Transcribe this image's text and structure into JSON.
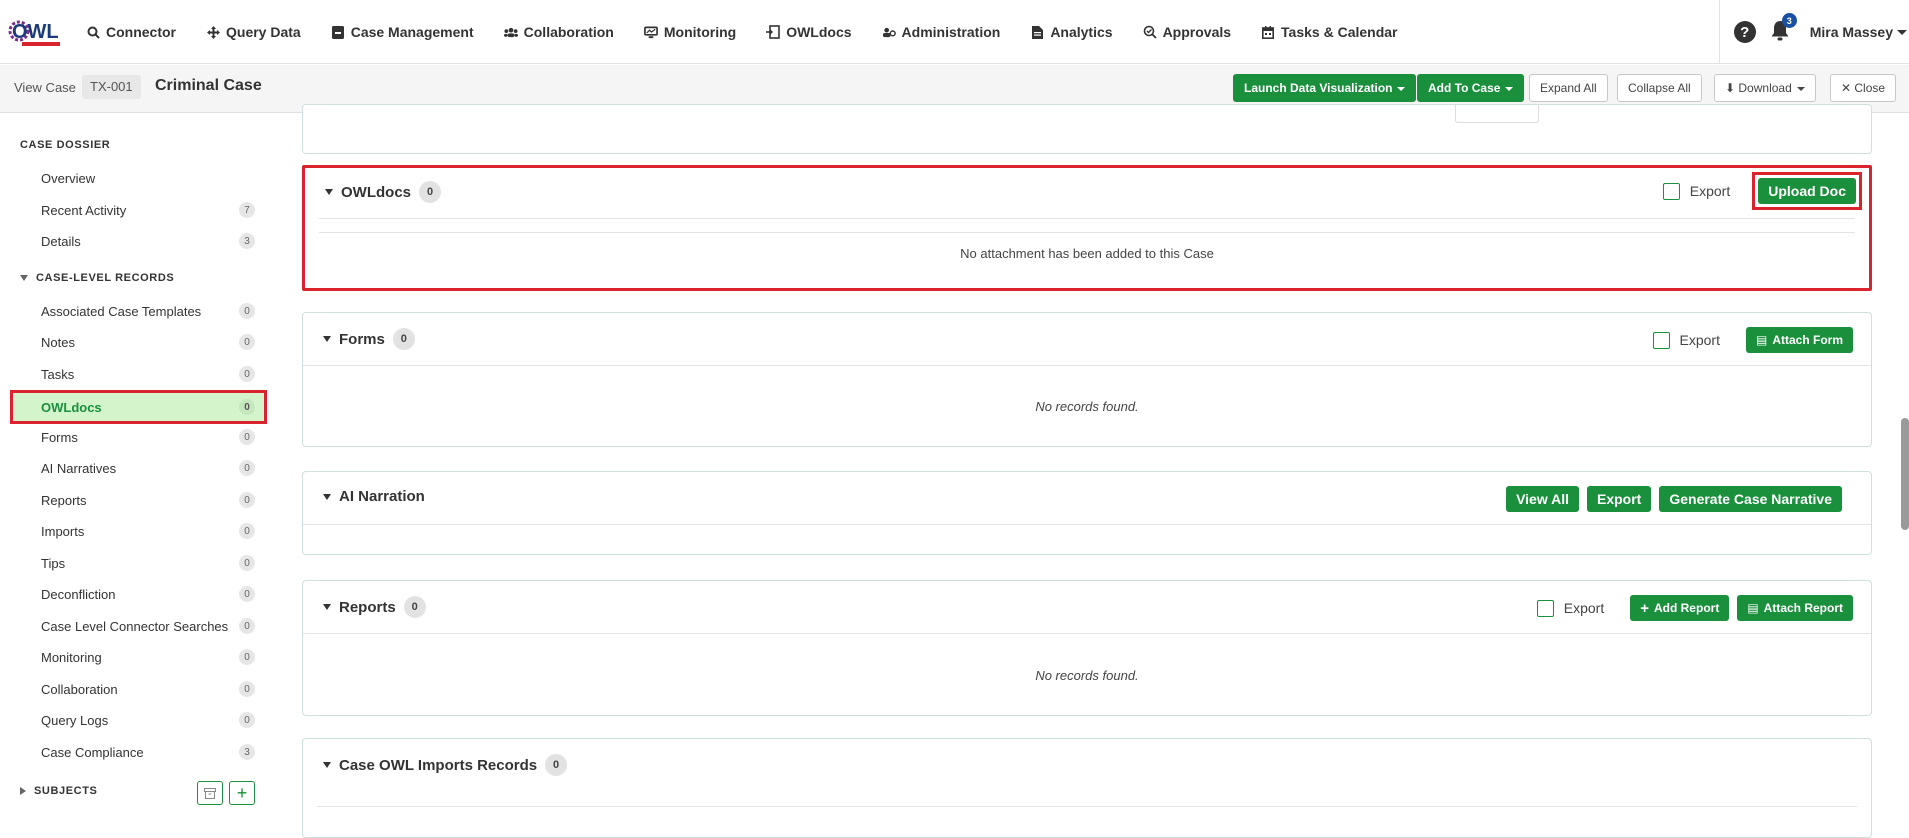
{
  "nav": {
    "logo_text": "OWL",
    "items": [
      {
        "label": "Connector",
        "icon": "search-icon"
      },
      {
        "label": "Query Data",
        "icon": "move-icon"
      },
      {
        "label": "Case Management",
        "icon": "case-icon"
      },
      {
        "label": "Collaboration",
        "icon": "users-icon"
      },
      {
        "label": "Monitoring",
        "icon": "monitor-icon"
      },
      {
        "label": "OWLdocs",
        "icon": "docs-icon"
      },
      {
        "label": "Administration",
        "icon": "admin-icon"
      },
      {
        "label": "Analytics",
        "icon": "file-icon"
      },
      {
        "label": "Approvals",
        "icon": "approval-icon"
      },
      {
        "label": "Tasks & Calendar",
        "icon": "calendar-icon"
      }
    ],
    "help_label": "?",
    "notification_count": "3",
    "user_name": "Mira Massey"
  },
  "subbar": {
    "view_label": "View Case",
    "case_id": "TX-001",
    "case_title": "Criminal Case",
    "buttons": {
      "launch": "Launch Data Visualization",
      "add_to_case": "Add To Case",
      "expand_all": "Expand All",
      "collapse_all": "Collapse All",
      "download": "Download",
      "close": "Close"
    }
  },
  "sidebar": {
    "dossier_heading": "CASE DOSSIER",
    "dossier_items": [
      {
        "label": "Overview",
        "count": ""
      },
      {
        "label": "Recent Activity",
        "count": "7"
      },
      {
        "label": "Details",
        "count": "3"
      }
    ],
    "records_heading": "CASE-LEVEL RECORDS",
    "records_items": [
      {
        "label": "Associated Case Templates",
        "count": "0"
      },
      {
        "label": "Notes",
        "count": "0"
      },
      {
        "label": "Tasks",
        "count": "0"
      },
      {
        "label": "OWLdocs",
        "count": "0"
      },
      {
        "label": "Forms",
        "count": "0"
      },
      {
        "label": "AI Narratives",
        "count": "0"
      },
      {
        "label": "Reports",
        "count": "0"
      },
      {
        "label": "Imports",
        "count": "0"
      },
      {
        "label": "Tips",
        "count": "0"
      },
      {
        "label": "Deconfliction",
        "count": "0"
      },
      {
        "label": "Case Level Connector Searches",
        "count": "0"
      },
      {
        "label": "Monitoring",
        "count": "0"
      },
      {
        "label": "Collaboration",
        "count": "0"
      },
      {
        "label": "Query Logs",
        "count": "0"
      },
      {
        "label": "Case Compliance",
        "count": "3"
      }
    ],
    "subjects_heading": "SUBJECTS"
  },
  "panels": {
    "owldocs": {
      "title": "OWLdocs",
      "count": "0",
      "export_label": "Export",
      "upload_label": "Upload Doc",
      "empty": "No attachment has been added to this Case"
    },
    "forms": {
      "title": "Forms",
      "count": "0",
      "export_label": "Export",
      "attach_label": "Attach Form",
      "empty": "No records found."
    },
    "ai": {
      "title": "AI Narration",
      "view_all": "View All",
      "export": "Export",
      "generate": "Generate Case Narrative"
    },
    "reports": {
      "title": "Reports",
      "count": "0",
      "export_label": "Export",
      "add_label": "Add Report",
      "attach_label": "Attach Report",
      "empty": "No records found."
    },
    "imports": {
      "title": "Case OWL Imports Records",
      "count": "0"
    }
  },
  "colors": {
    "accent_green": "#1a8f3c",
    "highlight_red": "#d9232d",
    "active_bg": "#d4f5cc"
  }
}
